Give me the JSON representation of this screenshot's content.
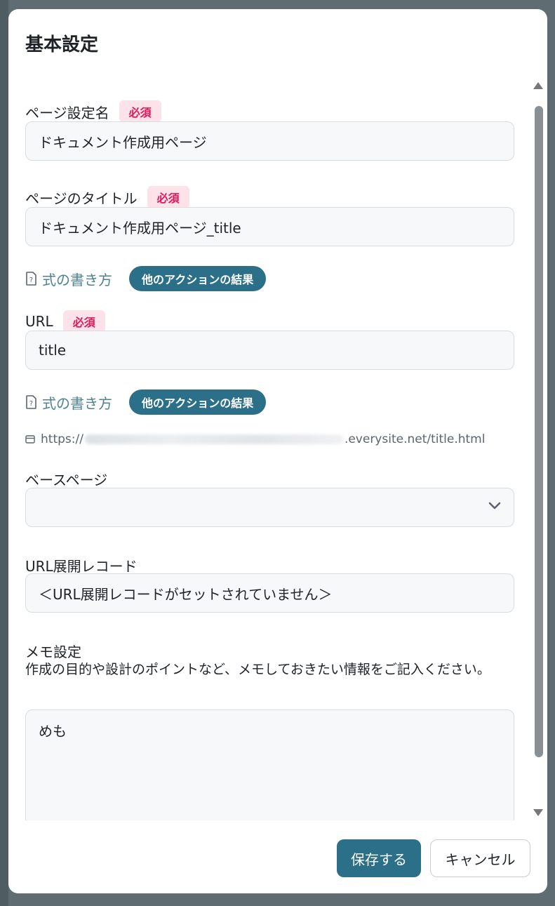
{
  "modal": {
    "title": "基本設定"
  },
  "fields": {
    "page_setting_name": {
      "label": "ページ設定名",
      "required": "必須",
      "value": "ドキュメント作成用ページ"
    },
    "page_title": {
      "label": "ページのタイトル",
      "required": "必須",
      "value": "ドキュメント作成用ページ_title"
    },
    "url": {
      "label": "URL",
      "required": "必須",
      "value": "title",
      "preview_prefix": "https://",
      "preview_suffix": ".everysite.net/title.html"
    },
    "base_page": {
      "label": "ベースページ",
      "value": ""
    },
    "url_record": {
      "label": "URL展開レコード",
      "value": "＜URL展開レコードがセットされていません＞"
    },
    "memo": {
      "label": "メモ設定",
      "description": "作成の目的や設計のポイントなど、メモしておきたい情報をご記入ください。",
      "value": "めも"
    }
  },
  "helpers": {
    "howto_label": "式の書き方",
    "action_result_label": "他のアクションの結果"
  },
  "footer": {
    "save_label": "保存する",
    "cancel_label": "キャンセル"
  },
  "colors": {
    "accent": "#2b6f88",
    "required_badge_bg": "#fde2ea",
    "required_badge_text": "#e0195b",
    "link": "#4d8391"
  }
}
